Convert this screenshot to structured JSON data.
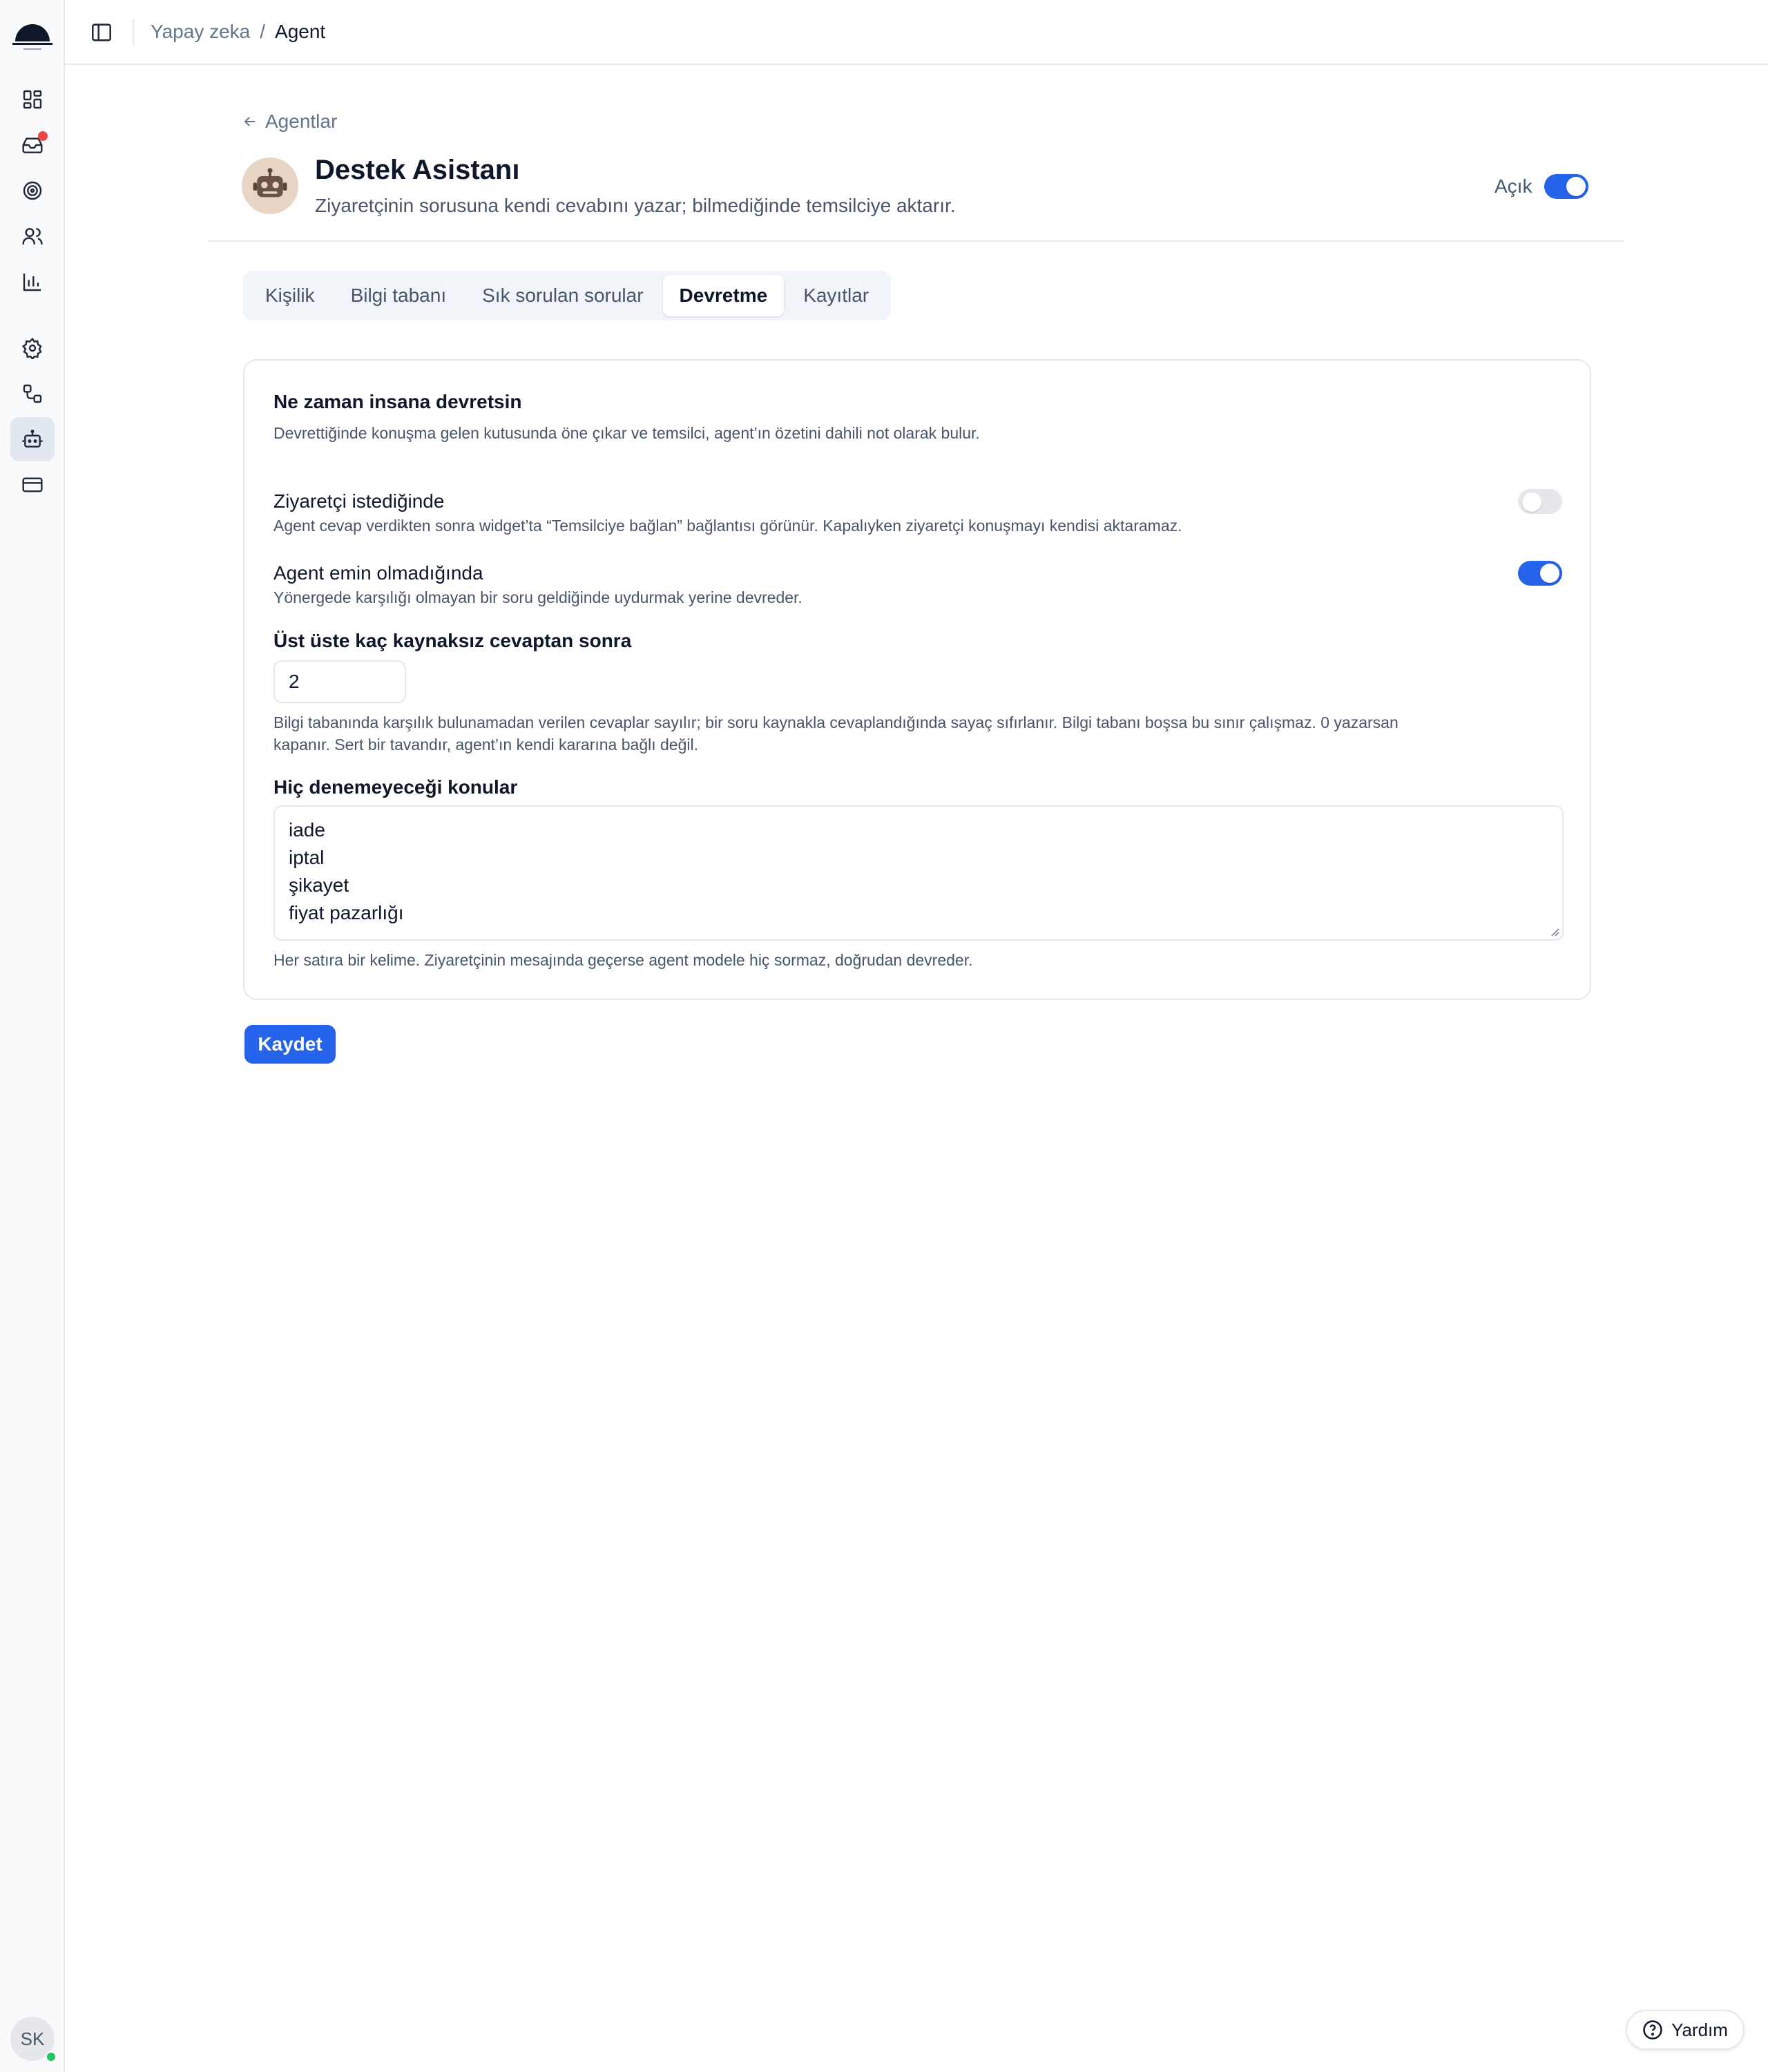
{
  "breadcrumb": {
    "parent": "Yapay zeka",
    "separator": "/",
    "current": "Agent"
  },
  "back_link": "Agentlar",
  "agent": {
    "name": "Destek Asistanı",
    "description": "Ziyaretçinin sorusuna kendi cevabını yazar; bilmediğinde temsilciye aktarır.",
    "status_label": "Açık",
    "enabled": true
  },
  "tabs": [
    {
      "label": "Kişilik",
      "active": false
    },
    {
      "label": "Bilgi tabanı",
      "active": false
    },
    {
      "label": "Sık sorulan sorular",
      "active": false
    },
    {
      "label": "Devretme",
      "active": true
    },
    {
      "label": "Kayıtlar",
      "active": false
    }
  ],
  "handoff": {
    "title": "Ne zaman insana devretsin",
    "description": "Devrettiğinde konuşma gelen kutusunda öne çıkar ve temsilci, agent’ın özetini dahili not olarak bulur.",
    "visitor_request": {
      "title": "Ziyaretçi istediğinde",
      "description": "Agent cevap verdikten sonra widget’ta “Temsilciye bağlan” bağlantısı görünür. Kapalıyken ziyaretçi konuşmayı kendisi aktaramaz.",
      "enabled": false
    },
    "agent_unsure": {
      "title": "Agent emin olmadığında",
      "description": "Yönergede karşılığı olmayan bir soru geldiğinde uydurmak yerine devreder.",
      "enabled": true
    },
    "unsourced": {
      "label": "Üst üste kaç kaynaksız cevaptan sonra",
      "value": "2",
      "help_line1": "Bilgi tabanında karşılık bulunamadan verilen cevaplar sayılır; bir soru kaynakla cevaplandığında sayaç sıfırlanır. Bilgi tabanı boşsa bu sınır çalışmaz. 0 yazarsan",
      "help_line2": "kapanır. Sert bir tavandır, agent’ın kendi kararına bağlı değil."
    },
    "topics": {
      "label": "Hiç denemeyeceği konular",
      "lines": [
        "iade",
        "iptal",
        "şikayet",
        "fiyat pazarlığı"
      ],
      "help": "Her satıra bir kelime. Ziyaretçinin mesajında geçerse agent modele hiç sormaz, doğrudan devreder."
    }
  },
  "save_label": "Kaydet",
  "help_button": "Yardım",
  "user_initials": "SK",
  "colors": {
    "accent": "#2563eb",
    "notification": "#ef4444",
    "online": "#22c55e"
  }
}
